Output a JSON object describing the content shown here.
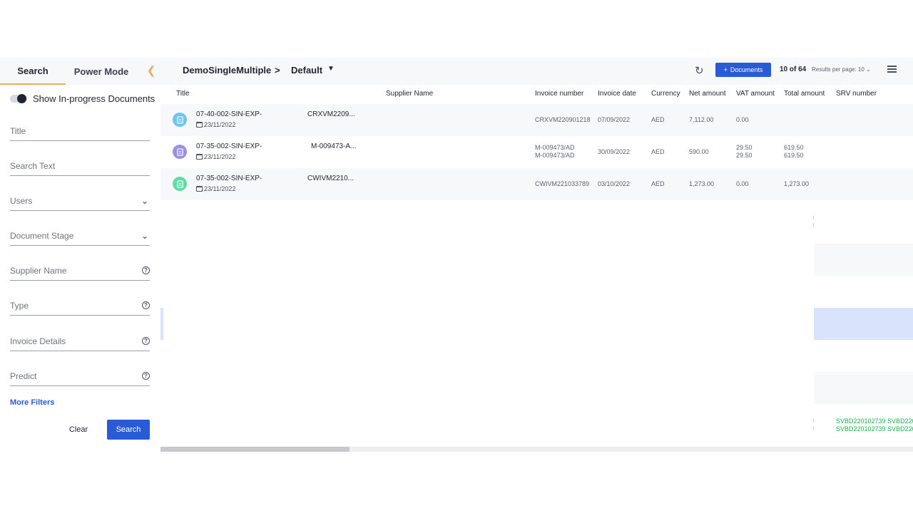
{
  "left_panel": {
    "tabs": [
      "Search",
      "Power Mode"
    ],
    "collapse_icon": "chevron-left-icon",
    "toggle_label": "Show In-progress Documents",
    "fields": {
      "title": "Title",
      "search_text": "Search Text",
      "users": "Users",
      "document_stage": "Document Stage",
      "supplier_name": "Supplier Name",
      "type": "Type",
      "invoice_details": "Invoice Details",
      "predict": "Predict"
    },
    "help_glyph": "?",
    "more_filters": "More Filters",
    "clear_label": "Clear",
    "search_label": "Search"
  },
  "topbar": {
    "breadcrumb": [
      "DemoSingleMultiple",
      "Default"
    ],
    "separator": ">",
    "add_documents_label": "Documents",
    "pager": "10 of 64",
    "results_per_page": "Results per page: 10"
  },
  "table": {
    "headers": {
      "title": "Title",
      "supplier": "Supplier Name",
      "invoice_number": "Invoice number",
      "invoice_date": "Invoice date",
      "currency": "Currency",
      "net": "Net amount",
      "vat": "VAT amount",
      "total": "Total amount",
      "srv": "SRV number"
    },
    "rows": [
      {
        "title": "07-40-002-SIN-EXP-",
        "subtitle": "CRXVM2209...",
        "date": "23/11/2022",
        "invoice_number": "CRXVM220901218",
        "invoice_number_2": "",
        "invoice_date": "07/09/2022",
        "currency": "AED",
        "net": "7,112.00",
        "vat": "0.00",
        "vat_2": "",
        "total": "",
        "total_2": ""
      },
      {
        "title": "07-35-002-SIN-EXP-",
        "subtitle": "M-009473-A...",
        "date": "23/11/2022",
        "invoice_number": "M-009473/AD",
        "invoice_number_2": "M-009473/AD",
        "invoice_date": "30/09/2022",
        "currency": "AED",
        "net": "590.00",
        "vat": "29.50",
        "vat_2": "29.50",
        "total": "619.50",
        "total_2": "619.50"
      },
      {
        "title": "07-35-002-SIN-EXP-",
        "subtitle": "CWIVM2210...",
        "date": "23/11/2022",
        "invoice_number": "CWIVM221033789",
        "invoice_number_2": "",
        "invoice_date": "03/10/2022",
        "currency": "AED",
        "net": "1,273.00",
        "vat": "0.00",
        "vat_2": "",
        "total": "1,273.00",
        "total_2": ""
      }
    ],
    "srv_fragments": [
      "SVBD220102739 SVBD220",
      "SVBD220102739 SVBD220"
    ]
  },
  "colors": {
    "accent": "#2a5bd7",
    "tab_underline": "#f0a85a",
    "doc_icon_blue": "#6fc3f0",
    "doc_icon_purple": "#9a90e6",
    "doc_icon_green": "#5fdcaa",
    "srv_green": "#1bb34a"
  }
}
